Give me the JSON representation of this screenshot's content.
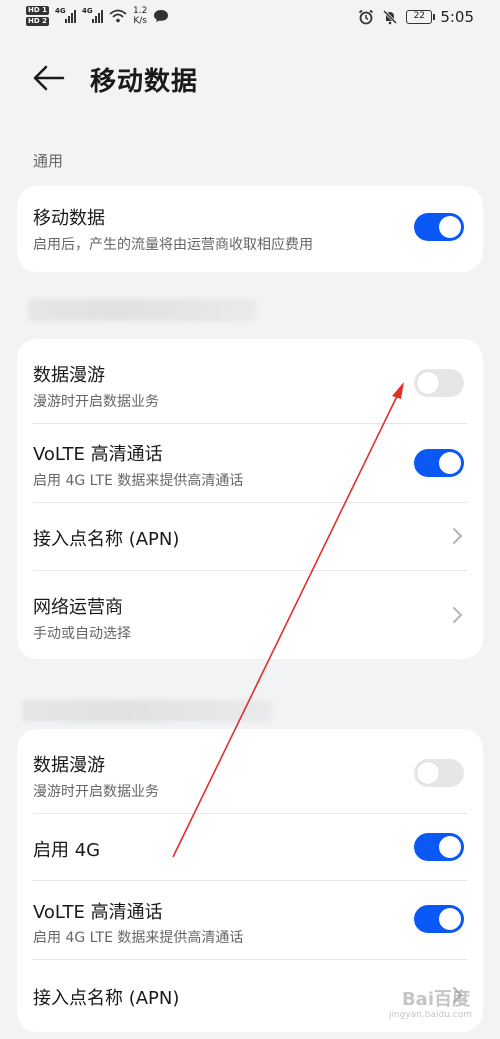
{
  "status_bar": {
    "hd1": "HD 1",
    "hd2": "HD 2",
    "net1": "4G",
    "net2": "4G",
    "speed_value": "1.2",
    "speed_unit": "K/s",
    "battery": "22",
    "time": "5:05",
    "icons": [
      "signal-icon",
      "wifi-icon",
      "message-icon",
      "alarm-icon",
      "mute-icon",
      "battery-icon"
    ]
  },
  "header": {
    "title": "移动数据",
    "back_icon": "arrow-left-icon"
  },
  "sections": {
    "general_label": "通用"
  },
  "card1": {
    "mobile_data": {
      "title": "移动数据",
      "subtitle": "启用后，产生的流量将由运营商收取相应费用",
      "enabled": true
    }
  },
  "card2": {
    "roaming": {
      "title": "数据漫游",
      "subtitle": "漫游时开启数据业务",
      "enabled": false
    },
    "volte": {
      "title": "VoLTE 高清通话",
      "subtitle": "启用 4G LTE 数据来提供高清通话",
      "enabled": true
    },
    "apn": {
      "title": "接入点名称 (APN)"
    },
    "operator": {
      "title": "网络运营商",
      "subtitle": "手动或自动选择"
    }
  },
  "card3": {
    "roaming": {
      "title": "数据漫游",
      "subtitle": "漫游时开启数据业务",
      "enabled": false
    },
    "enable_4g": {
      "title": "启用 4G",
      "enabled": true
    },
    "volte": {
      "title": "VoLTE 高清通话",
      "subtitle": "启用 4G LTE 数据来提供高清通话",
      "enabled": true
    },
    "apn": {
      "title": "接入点名称 (APN)"
    }
  },
  "colors": {
    "accent": "#0a59f7",
    "background": "#f1f3f5",
    "annotation_arrow": "#e0302a"
  },
  "watermark": {
    "text": "Bai百度",
    "sub": "jingyan.baidu.com"
  }
}
